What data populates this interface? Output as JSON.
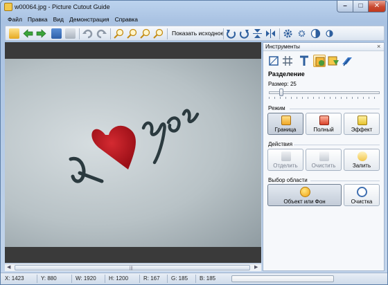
{
  "window": {
    "title": "w00064.jpg - Picture Cutout Guide"
  },
  "menu": [
    "Файл",
    "Правка",
    "Вид",
    "Демонстрация",
    "Справка"
  ],
  "toolbar": {
    "show_original": "Показать исходное"
  },
  "panel": {
    "title": "Инструменты",
    "section": "Разделение",
    "size_label": "Размер: 25",
    "size_value": 25,
    "mode_label": "Режим",
    "modes": [
      "Граница",
      "Полный",
      "Эффект"
    ],
    "actions_label": "Действия",
    "actions": [
      "Отделить",
      "Очистить",
      "Залить"
    ],
    "region_label": "Выбор области",
    "region_object": "Объект или Фон",
    "region_clear": "Очистка"
  },
  "status": {
    "x": "X: 1423",
    "y": "Y: 880",
    "w": "W: 1920",
    "h": "H: 1200",
    "r": "R: 167",
    "g": "G: 185",
    "b": "B: 185"
  },
  "photo": {
    "text_left": "I",
    "text_right": "you"
  },
  "colors": {
    "heart": "#b5141c",
    "accent_active": "#ffd36b",
    "canvas": "#3a3a3a"
  }
}
